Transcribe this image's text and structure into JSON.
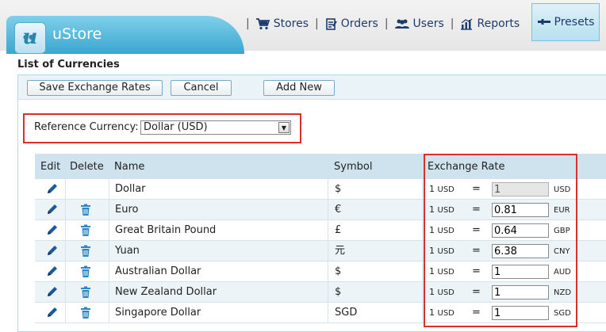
{
  "app": {
    "title": "uStore",
    "logo_letter": "u"
  },
  "nav": {
    "items": [
      {
        "label": "Stores",
        "icon": "cart-icon"
      },
      {
        "label": "Orders",
        "icon": "orders-icon"
      },
      {
        "label": "Users",
        "icon": "users-icon"
      },
      {
        "label": "Reports",
        "icon": "reports-icon"
      }
    ],
    "active": {
      "label": "Presets",
      "icon": "wrench-icon"
    }
  },
  "page": {
    "title": "List of Currencies"
  },
  "toolbar": {
    "save_label": "Save Exchange Rates",
    "cancel_label": "Cancel",
    "add_label": "Add New"
  },
  "reference": {
    "label": "Reference Currency:",
    "value": "Dollar (USD)"
  },
  "table": {
    "headers": {
      "edit": "Edit",
      "delete": "Delete",
      "name": "Name",
      "symbol": "Symbol",
      "rate": "Exchange Rate"
    },
    "base_one": "1",
    "base_code": "USD",
    "equals": "=",
    "rows": [
      {
        "name": "Dollar",
        "symbol": "$",
        "rate": "1",
        "code": "USD",
        "deletable": false,
        "disabled": true
      },
      {
        "name": "Euro",
        "symbol": "€",
        "rate": "0.81",
        "code": "EUR",
        "deletable": true,
        "disabled": false
      },
      {
        "name": "Great Britain Pound",
        "symbol": "£",
        "rate": "0.64",
        "code": "GBP",
        "deletable": true,
        "disabled": false
      },
      {
        "name": "Yuan",
        "symbol": "元",
        "rate": "6.38",
        "code": "CNY",
        "deletable": true,
        "disabled": false
      },
      {
        "name": "Australian Dollar",
        "symbol": "$",
        "rate": "1",
        "code": "AUD",
        "deletable": true,
        "disabled": false
      },
      {
        "name": "New Zealand Dollar",
        "symbol": "$",
        "rate": "1",
        "code": "NZD",
        "deletable": true,
        "disabled": false
      },
      {
        "name": "Singapore Dollar",
        "symbol": "SGD",
        "rate": "1",
        "code": "SGD",
        "deletable": true,
        "disabled": false
      }
    ]
  },
  "colors": {
    "accent": "#3aa6cf",
    "highlight_border": "#d9302c",
    "header_bg": "#cfe3ee",
    "nav_text": "#1d3c6e"
  }
}
